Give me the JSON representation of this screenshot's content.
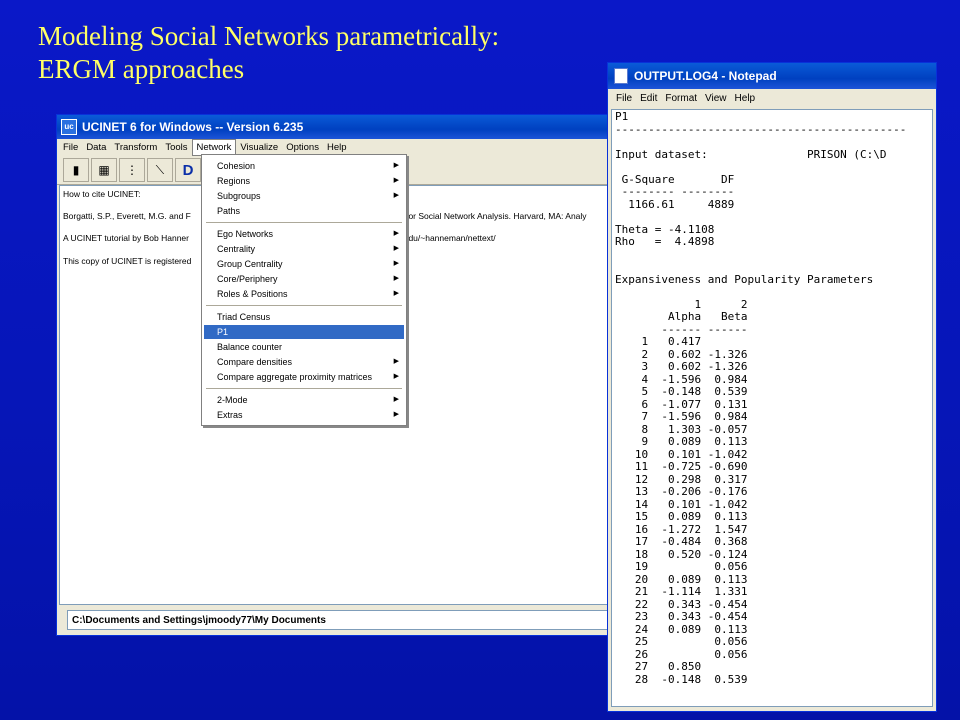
{
  "slide": {
    "title_line1": "Modeling Social Networks parametrically:",
    "title_line2": "ERGM approaches"
  },
  "ucinet": {
    "title": "UCINET 6 for Windows -- Version 6.235",
    "menus": [
      "File",
      "Data",
      "Transform",
      "Tools",
      "Network",
      "Visualize",
      "Options",
      "Help"
    ],
    "active_menu": "Network",
    "toolbar_d_label": "D",
    "content_lines": [
      "How to cite UCINET:",
      "Borgatti, S.P., Everett, M.G. and F",
      "e for Social Network Analysis. Harvard, MA: Analy",
      "A UCINET tutorial by Bob Hanner",
      "r.edu/~hanneman/nettext/",
      "This copy of UCINET is registered"
    ],
    "status_path": "C:\\Documents and Settings\\jmoody77\\My Documents"
  },
  "network_menu": {
    "groups": [
      [
        {
          "label": "Cohesion",
          "submenu": true
        },
        {
          "label": "Regions",
          "submenu": true
        },
        {
          "label": "Subgroups",
          "submenu": true
        },
        {
          "label": "Paths",
          "submenu": false
        }
      ],
      [
        {
          "label": "Ego Networks",
          "submenu": true
        },
        {
          "label": "Centrality",
          "submenu": true
        },
        {
          "label": "Group Centrality",
          "submenu": true
        },
        {
          "label": "Core/Periphery",
          "submenu": true
        },
        {
          "label": "Roles & Positions",
          "submenu": true
        }
      ],
      [
        {
          "label": "Triad Census",
          "submenu": false
        },
        {
          "label": "P1",
          "submenu": false,
          "selected": true
        },
        {
          "label": "Balance counter",
          "submenu": false
        },
        {
          "label": "Compare densities",
          "submenu": true
        },
        {
          "label": "Compare aggregate proximity matrices",
          "submenu": true
        }
      ],
      [
        {
          "label": "2-Mode",
          "submenu": true
        },
        {
          "label": "Extras",
          "submenu": true
        }
      ]
    ]
  },
  "notepad": {
    "title": "OUTPUT.LOG4 - Notepad",
    "menus": [
      "File",
      "Edit",
      "Format",
      "View",
      "Help"
    ],
    "lines": [
      "P1",
      "--------------------------------------------",
      "",
      "Input dataset:               PRISON (C:\\D",
      "",
      " G-Square       DF",
      " -------- --------",
      "  1166.61     4889",
      "",
      "Theta = -4.1108",
      "Rho   =  4.4898",
      "",
      "",
      "Expansiveness and Popularity Parameters",
      "",
      "            1      2",
      "        Alpha   Beta",
      "       ------ ------",
      "    1   0.417",
      "    2   0.602 -1.326",
      "    3   0.602 -1.326",
      "    4  -1.596  0.984",
      "    5  -0.148  0.539",
      "    6  -1.077  0.131",
      "    7  -1.596  0.984",
      "    8   1.303 -0.057",
      "    9   0.089  0.113",
      "   10   0.101 -1.042",
      "   11  -0.725 -0.690",
      "   12   0.298  0.317",
      "   13  -0.206 -0.176",
      "   14   0.101 -1.042",
      "   15   0.089  0.113",
      "   16  -1.272  1.547",
      "   17  -0.484  0.368",
      "   18   0.520 -0.124",
      "   19          0.056",
      "   20   0.089  0.113",
      "   21  -1.114  1.331",
      "   22   0.343 -0.454",
      "   23   0.343 -0.454",
      "   24   0.089  0.113",
      "   25          0.056",
      "   26          0.056",
      "   27   0.850",
      "   28  -0.148  0.539"
    ]
  }
}
